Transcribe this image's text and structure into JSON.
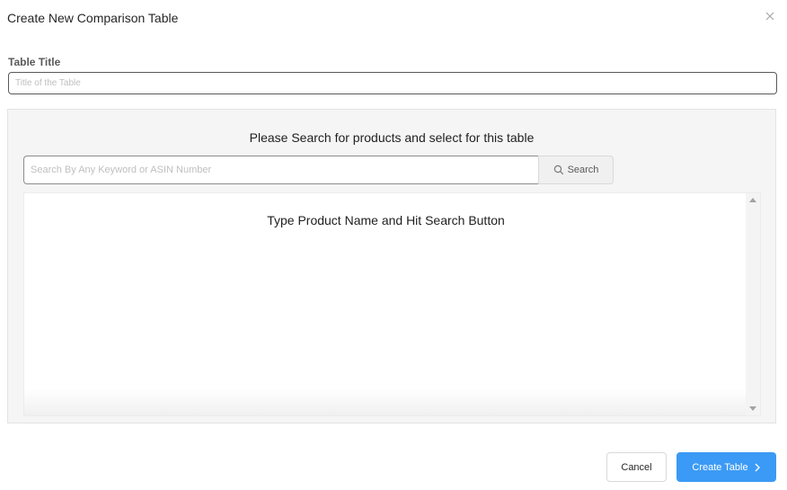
{
  "dialog": {
    "title": "Create New Comparison Table",
    "close_icon": "close-icon"
  },
  "table_title": {
    "label": "Table Title",
    "value": "",
    "placeholder": "Title of the Table"
  },
  "search": {
    "heading": "Please Search for products and select for this table",
    "value": "",
    "placeholder": "Search By Any Keyword or ASIN Number",
    "button_label": "Search",
    "button_icon": "search-icon"
  },
  "results": {
    "empty_message": "Type Product Name and Hit Search Button"
  },
  "footer": {
    "cancel_label": "Cancel",
    "create_label": "Create Table",
    "create_icon": "chevron-right-icon"
  },
  "colors": {
    "primary": "#3b9af5",
    "panel_background": "#f5f5f5",
    "border": "#d9d9d9"
  }
}
